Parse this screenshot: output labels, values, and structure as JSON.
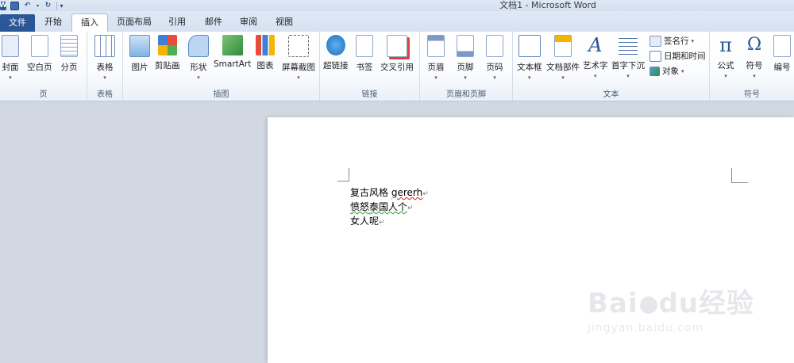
{
  "window": {
    "title": "文档1  -  Microsoft Word"
  },
  "quick_access": [
    {
      "icon": "word-logo-icon"
    },
    {
      "icon": "save-icon"
    },
    {
      "icon": "undo-icon"
    },
    {
      "icon": "redo-icon"
    },
    {
      "icon": "customize-qat-icon"
    }
  ],
  "tabs": [
    {
      "label": "文件"
    },
    {
      "label": "开始"
    },
    {
      "label": "插入"
    },
    {
      "label": "页面布局"
    },
    {
      "label": "引用"
    },
    {
      "label": "邮件"
    },
    {
      "label": "审阅"
    },
    {
      "label": "视图"
    }
  ],
  "active_tab": "插入",
  "ribbon": {
    "groups": [
      {
        "label": "页",
        "buttons": [
          {
            "label": "封面",
            "icon": "cover-page-icon"
          },
          {
            "label": "空白页",
            "icon": "blank-page-icon"
          },
          {
            "label": "分页",
            "icon": "page-break-icon"
          }
        ]
      },
      {
        "label": "表格",
        "buttons": [
          {
            "label": "表格",
            "icon": "table-icon"
          }
        ]
      },
      {
        "label": "插图",
        "buttons": [
          {
            "label": "图片",
            "icon": "picture-icon"
          },
          {
            "label": "剪贴画",
            "icon": "clip-art-icon"
          },
          {
            "label": "形状",
            "icon": "shapes-icon"
          },
          {
            "label": "SmartArt",
            "icon": "smartart-icon"
          },
          {
            "label": "图表",
            "icon": "chart-icon"
          },
          {
            "label": "屏幕截图",
            "icon": "screenshot-icon"
          }
        ]
      },
      {
        "label": "链接",
        "buttons": [
          {
            "label": "超链接",
            "icon": "hyperlink-icon"
          },
          {
            "label": "书签",
            "icon": "bookmark-icon"
          },
          {
            "label": "交叉引用",
            "icon": "cross-reference-icon"
          }
        ]
      },
      {
        "label": "页眉和页脚",
        "buttons": [
          {
            "label": "页眉",
            "icon": "header-icon"
          },
          {
            "label": "页脚",
            "icon": "footer-icon"
          },
          {
            "label": "页码",
            "icon": "page-number-icon"
          }
        ]
      },
      {
        "label": "文本",
        "buttons": [
          {
            "label": "文本框",
            "icon": "text-box-icon"
          },
          {
            "label": "文档部件",
            "icon": "quick-parts-icon"
          },
          {
            "label": "艺术字",
            "icon": "wordart-icon"
          },
          {
            "label": "首字下沉",
            "icon": "drop-cap-icon"
          }
        ],
        "small": [
          {
            "label": "签名行",
            "icon": "signature-line-icon"
          },
          {
            "label": "日期和时间",
            "icon": "date-time-icon"
          },
          {
            "label": "对象",
            "icon": "object-icon"
          }
        ]
      },
      {
        "label": "符号",
        "buttons": [
          {
            "label": "公式",
            "icon": "equation-icon"
          },
          {
            "label": "符号",
            "icon": "symbol-icon"
          },
          {
            "label": "编号",
            "icon": "number-icon"
          }
        ]
      }
    ]
  },
  "document": {
    "lines": [
      {
        "text_a": "复古风格 ",
        "text_b": "gererh",
        "mark": "↵"
      },
      {
        "text_a": "愤怒",
        "text_b": "泰国人个",
        "mark": "↵"
      },
      {
        "text_a": "女人呢",
        "text_b": "",
        "mark": "↵"
      }
    ]
  },
  "watermark": {
    "brand": "Bai",
    "brand2": "du",
    "cn": "经验",
    "url": "jingyan.baidu.com"
  },
  "colors": {
    "file_tab": "#2b5797",
    "ribbon_bg": "#ffffff",
    "workarea": "#d2d8e2"
  }
}
